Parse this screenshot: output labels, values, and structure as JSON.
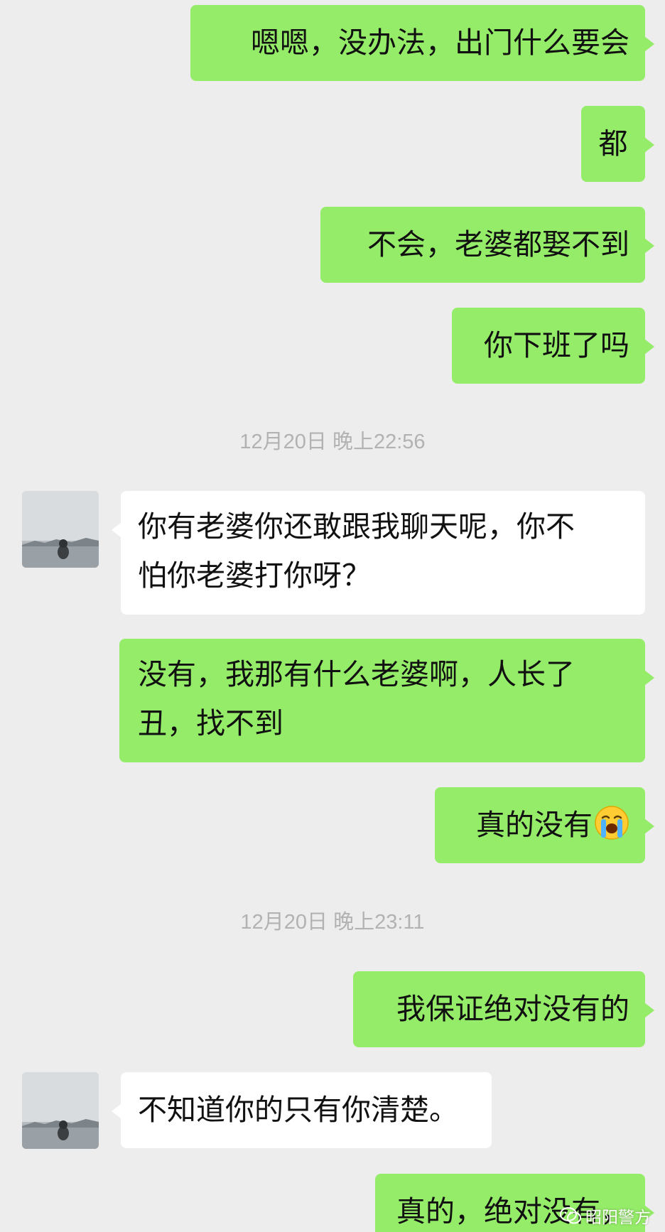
{
  "messages": [
    {
      "text": "嗯嗯，没办法，出门什么要会"
    },
    {
      "text": "都"
    },
    {
      "text": "不会，老婆都娶不到"
    },
    {
      "text": "你下班了吗"
    },
    {
      "timestamp": "12月20日 晚上22:56"
    },
    {
      "text_line1": "你有老婆你还敢跟我聊天呢，你不",
      "text_line2": "怕你老婆打你呀？"
    },
    {
      "text_line1": "没有，我那有什么老婆啊，人长了",
      "text_line2": "丑，找不到"
    },
    {
      "text": "真的没有",
      "emoji": "loudly-crying-face"
    },
    {
      "timestamp": "12月20日 晚上23:11"
    },
    {
      "text": "我保证绝对没有的"
    },
    {
      "text": "不知道你的只有你清楚。"
    },
    {
      "text": "真的，绝对没有，"
    }
  ],
  "watermark": {
    "text": "昭阳警方",
    "icon": "wechat-official-account-icon"
  },
  "colors": {
    "outgoing_bubble": "#95ec69",
    "incoming_bubble": "#ffffff",
    "background": "#ededed",
    "timestamp": "#b2b2b2"
  }
}
